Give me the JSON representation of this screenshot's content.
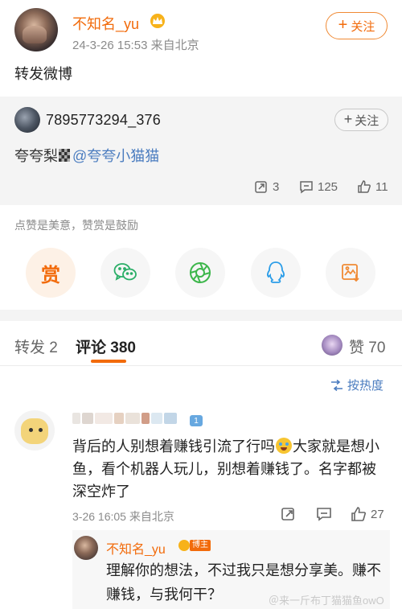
{
  "post": {
    "username": "不知名_yu",
    "meta": "24-3-26 15:53  来自北京",
    "follow_label": "关注",
    "text": "转发微博"
  },
  "retweet": {
    "username": "7895773294_376",
    "follow_label": "关注",
    "text_prefix": "夸夸梨",
    "mention": "@夸夸小猫猫",
    "stats": {
      "reposts": "3",
      "comments": "125",
      "likes": "11"
    }
  },
  "reward": {
    "note": "点赞是美意，赞赏是鼓励",
    "reward_label": "赏",
    "share_targets": [
      "wechat-icon",
      "moments-icon",
      "qq-icon",
      "save-image-icon"
    ]
  },
  "tabs": {
    "repost": "转发 2",
    "comment": "评论 380",
    "like": "赞 70"
  },
  "sort": {
    "label": "按热度"
  },
  "comment": {
    "badge": "1",
    "text": [
      "背后的人别想着赚钱引流了行吗",
      "大家就是想小鱼，看个机器人玩儿，别想着赚钱了。名字都被深空炸了"
    ],
    "meta": "3-26 16:05  来自北京",
    "likes": "27"
  },
  "reply": {
    "username": "不知名_yu",
    "tag": "博主",
    "text": "理解你的想法，不过我只是想分享美。赚不赚钱，与我何干？"
  },
  "watermark": "＠来一斤布丁猫猫鱼owO",
  "colors": {
    "accent": "#f26b0b",
    "link": "#4a7cbf",
    "wechat": "#2aae67",
    "qq": "#2b9de8",
    "moments": "#3cb64a"
  }
}
